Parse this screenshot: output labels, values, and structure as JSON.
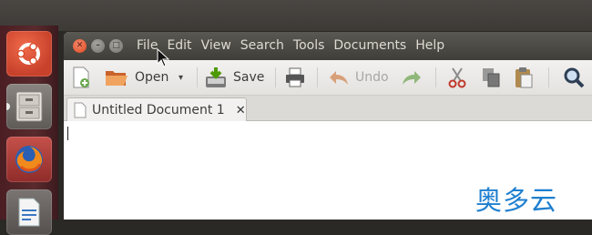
{
  "menubar": {
    "items": [
      "File",
      "Edit",
      "View",
      "Search",
      "Tools",
      "Documents",
      "Help"
    ]
  },
  "toolbar": {
    "new_label": "",
    "open_label": "Open",
    "save_label": "Save",
    "undo_label": "Undo"
  },
  "tab": {
    "title": "Untitled Document 1",
    "close_glyph": "✕"
  },
  "window_buttons": {
    "close_glyph": "✕",
    "min_glyph": "–",
    "max_glyph": "□"
  },
  "watermark": "奥多云",
  "colors": {
    "titlebar": "#4b4a45",
    "launcher": "#5a2a2d",
    "close_button": "#df4a20",
    "watermark": "#1f7fcf"
  }
}
